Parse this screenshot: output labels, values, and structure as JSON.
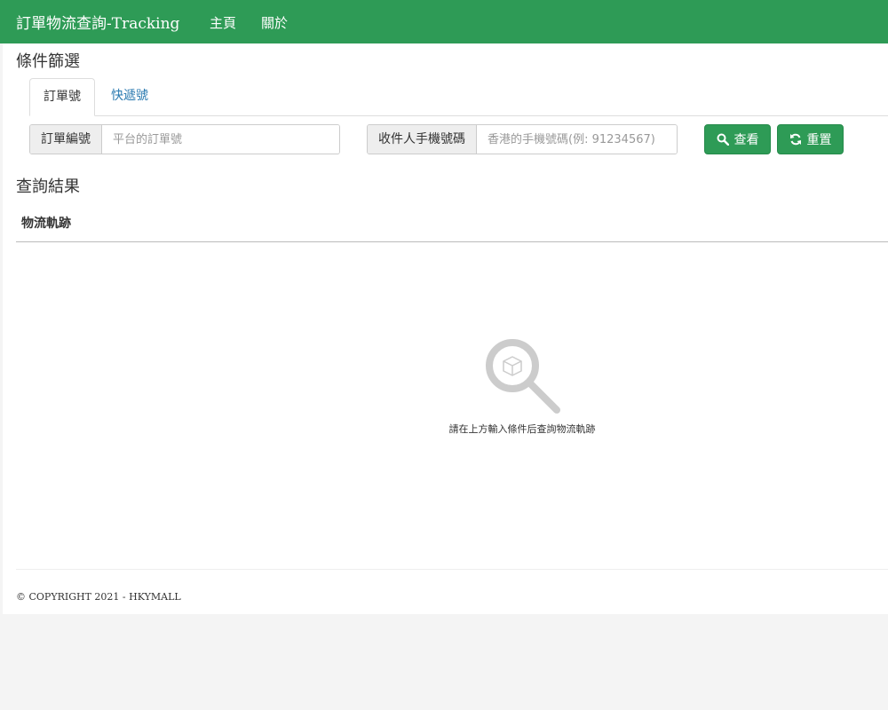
{
  "navbar": {
    "brand": "訂單物流查詢-Tracking",
    "links": [
      "主頁",
      "關於"
    ]
  },
  "filter": {
    "title": "條件篩選",
    "tabs": [
      {
        "label": "訂單號",
        "active": true
      },
      {
        "label": "快遞號",
        "active": false
      }
    ],
    "order_field": {
      "label": "訂單編號",
      "placeholder": "平台的訂單號",
      "value": ""
    },
    "phone_field": {
      "label": "收件人手機號碼",
      "placeholder": "香港的手機號碼(例: 91234567)",
      "value": ""
    },
    "search_button": "查看",
    "reset_button": "重置"
  },
  "results": {
    "title": "查詢結果",
    "tracking_header": "物流軌跡",
    "empty_message": "請在上方輸入條件后查詢物流軌跡"
  },
  "footer": {
    "copyright": "© COPYRIGHT 2021 - HKYMALL"
  },
  "colors": {
    "brand": "#2e9b56",
    "link": "#2a7ab0"
  }
}
